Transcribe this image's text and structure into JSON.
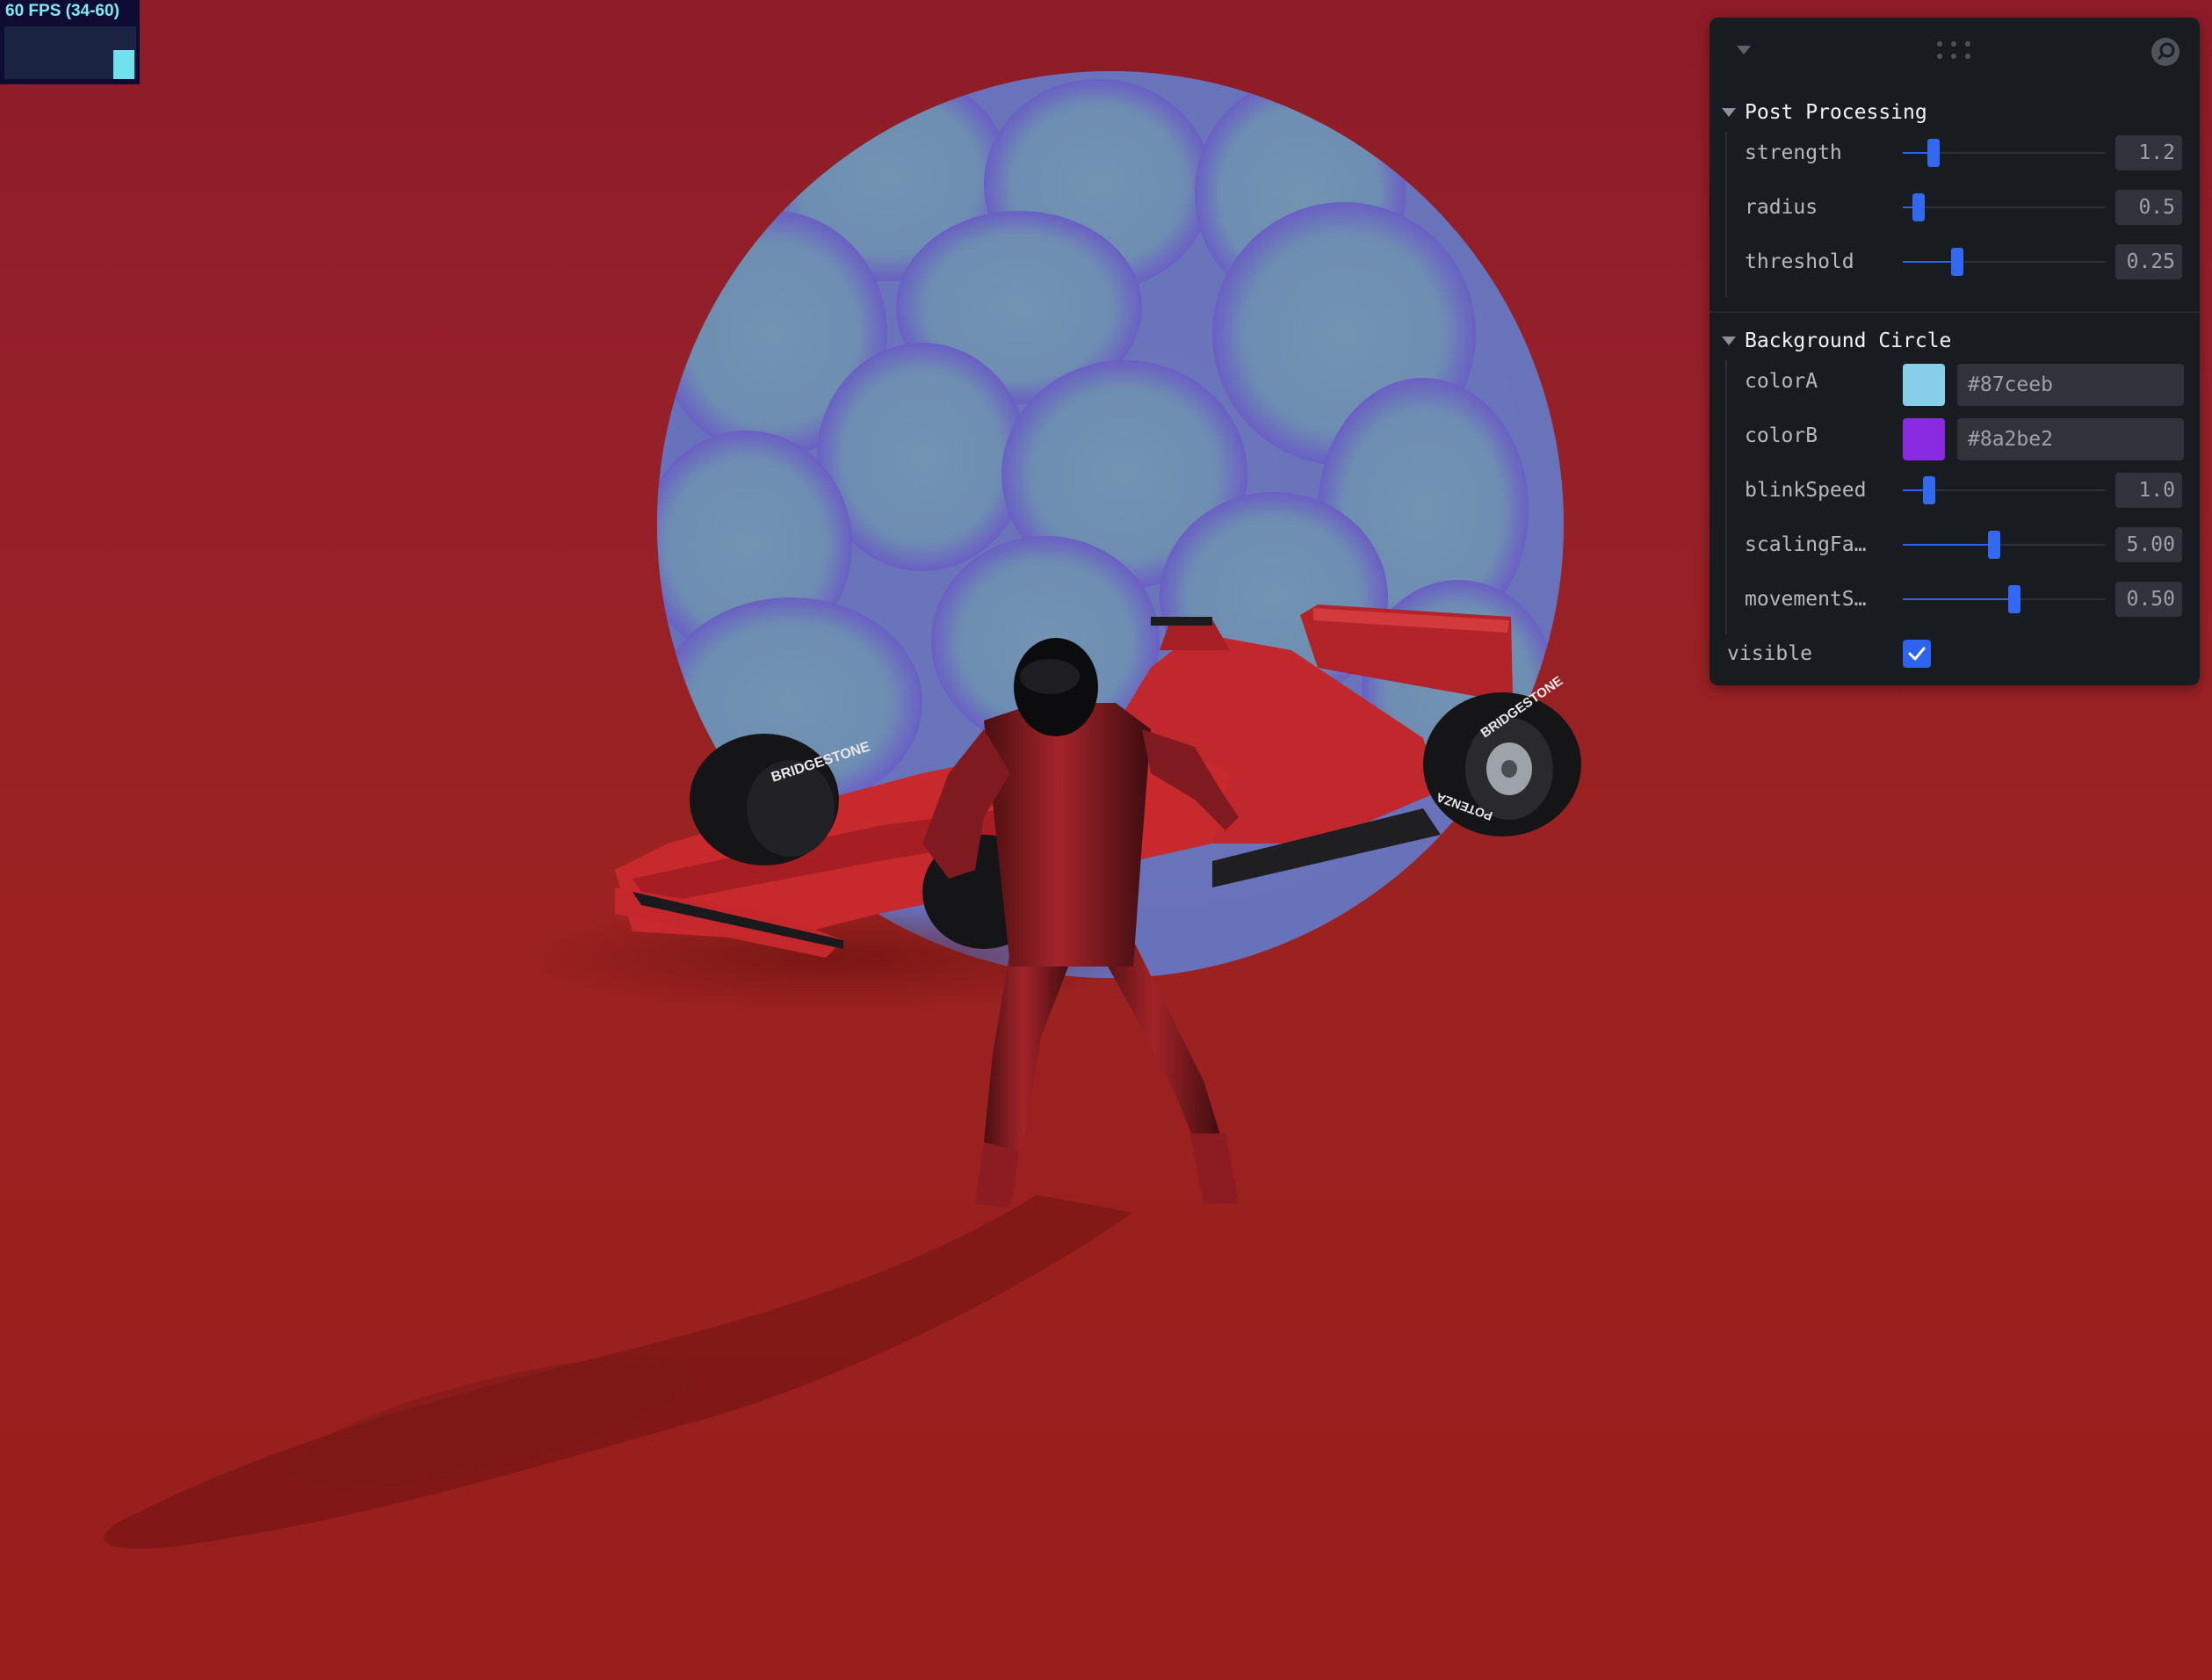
{
  "fps": {
    "label": "60 FPS (34-60)",
    "bar_level": 0.55
  },
  "scene": {
    "description_colors": {
      "floor": "#9a2020",
      "circle_a": "#87ceeb",
      "circle_b": "#8a2be2",
      "car": "#c4262a"
    },
    "tire_brand": "BRIDGESTONE",
    "tire_model": "POTENZA"
  },
  "panel": {
    "titlebar": {
      "toggle_icon": "chevron-down-icon",
      "drag_icon": "drag-handle-icon",
      "search_icon": "search-icon"
    },
    "post_processing": {
      "title": "Post Processing",
      "strength": {
        "label": "strength",
        "value": "1.2",
        "level": 0.15
      },
      "radius": {
        "label": "radius",
        "value": "0.5",
        "level": 0.08
      },
      "threshold": {
        "label": "threshold",
        "value": "0.25",
        "level": 0.27
      }
    },
    "background_circle": {
      "title": "Background Circle",
      "colorA": {
        "label": "colorA",
        "value": "#87ceeb",
        "swatch": "#87ceeb"
      },
      "colorB": {
        "label": "colorB",
        "value": "#8a2be2",
        "swatch": "#8a2be2"
      },
      "blinkSpeed": {
        "label": "blinkSpeed",
        "value": "1.0",
        "level": 0.13
      },
      "scalingFactor": {
        "label": "scalingFa…",
        "value": "5.00",
        "level": 0.45
      },
      "movementSpeed": {
        "label": "movementS…",
        "value": "0.50",
        "level": 0.55
      },
      "visible": {
        "label": "visible",
        "checked": true
      }
    }
  }
}
